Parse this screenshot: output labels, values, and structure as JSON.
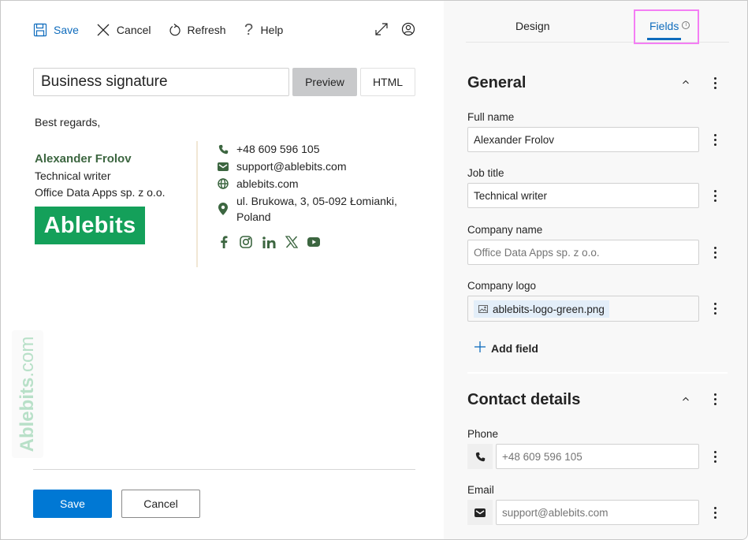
{
  "toolbar": {
    "save": "Save",
    "cancel": "Cancel",
    "refresh": "Refresh",
    "help": "Help",
    "icons": [
      "save-icon",
      "close-icon",
      "refresh-icon",
      "help-icon",
      "expand-icon",
      "account-icon"
    ]
  },
  "editor": {
    "signature_name": "Business signature",
    "view_modes": [
      "Preview",
      "HTML"
    ],
    "active_view": "Preview"
  },
  "signature": {
    "greeting": "Best regards,",
    "name": "Alexander Frolov",
    "job_title": "Technical writer",
    "company": "Office Data Apps sp. z o.o.",
    "logo_text": "Ablebits",
    "phone": "+48 609 596 105",
    "email": "support@ablebits.com",
    "website": "ablebits.com",
    "address": "ul. Brukowa, 3, 05-092 Łomianki, Poland",
    "socials": [
      "facebook",
      "instagram",
      "linkedin",
      "x",
      "youtube"
    ],
    "accent_color": "#3c6640",
    "logo_color": "#14a05a"
  },
  "watermark": {
    "brand": "Ablebits",
    "suffix": ".com"
  },
  "footer": {
    "save": "Save",
    "cancel": "Cancel"
  },
  "panel": {
    "tabs": [
      "Design",
      "Fields"
    ],
    "active_tab": "Fields",
    "general": {
      "title": "General",
      "fields": {
        "full_name": {
          "label": "Full name",
          "value": "Alexander Frolov"
        },
        "job_title": {
          "label": "Job title",
          "value": "Technical writer"
        },
        "company_name": {
          "label": "Company name",
          "placeholder": "Office Data Apps sp. z o.o."
        },
        "company_logo": {
          "label": "Company logo",
          "value": "ablebits-logo-green.png"
        }
      },
      "add_field": "Add field"
    },
    "contact": {
      "title": "Contact details",
      "fields": {
        "phone": {
          "label": "Phone",
          "placeholder": "+48 609 596 105"
        },
        "email": {
          "label": "Email",
          "placeholder": "support@ablebits.com"
        }
      }
    }
  }
}
